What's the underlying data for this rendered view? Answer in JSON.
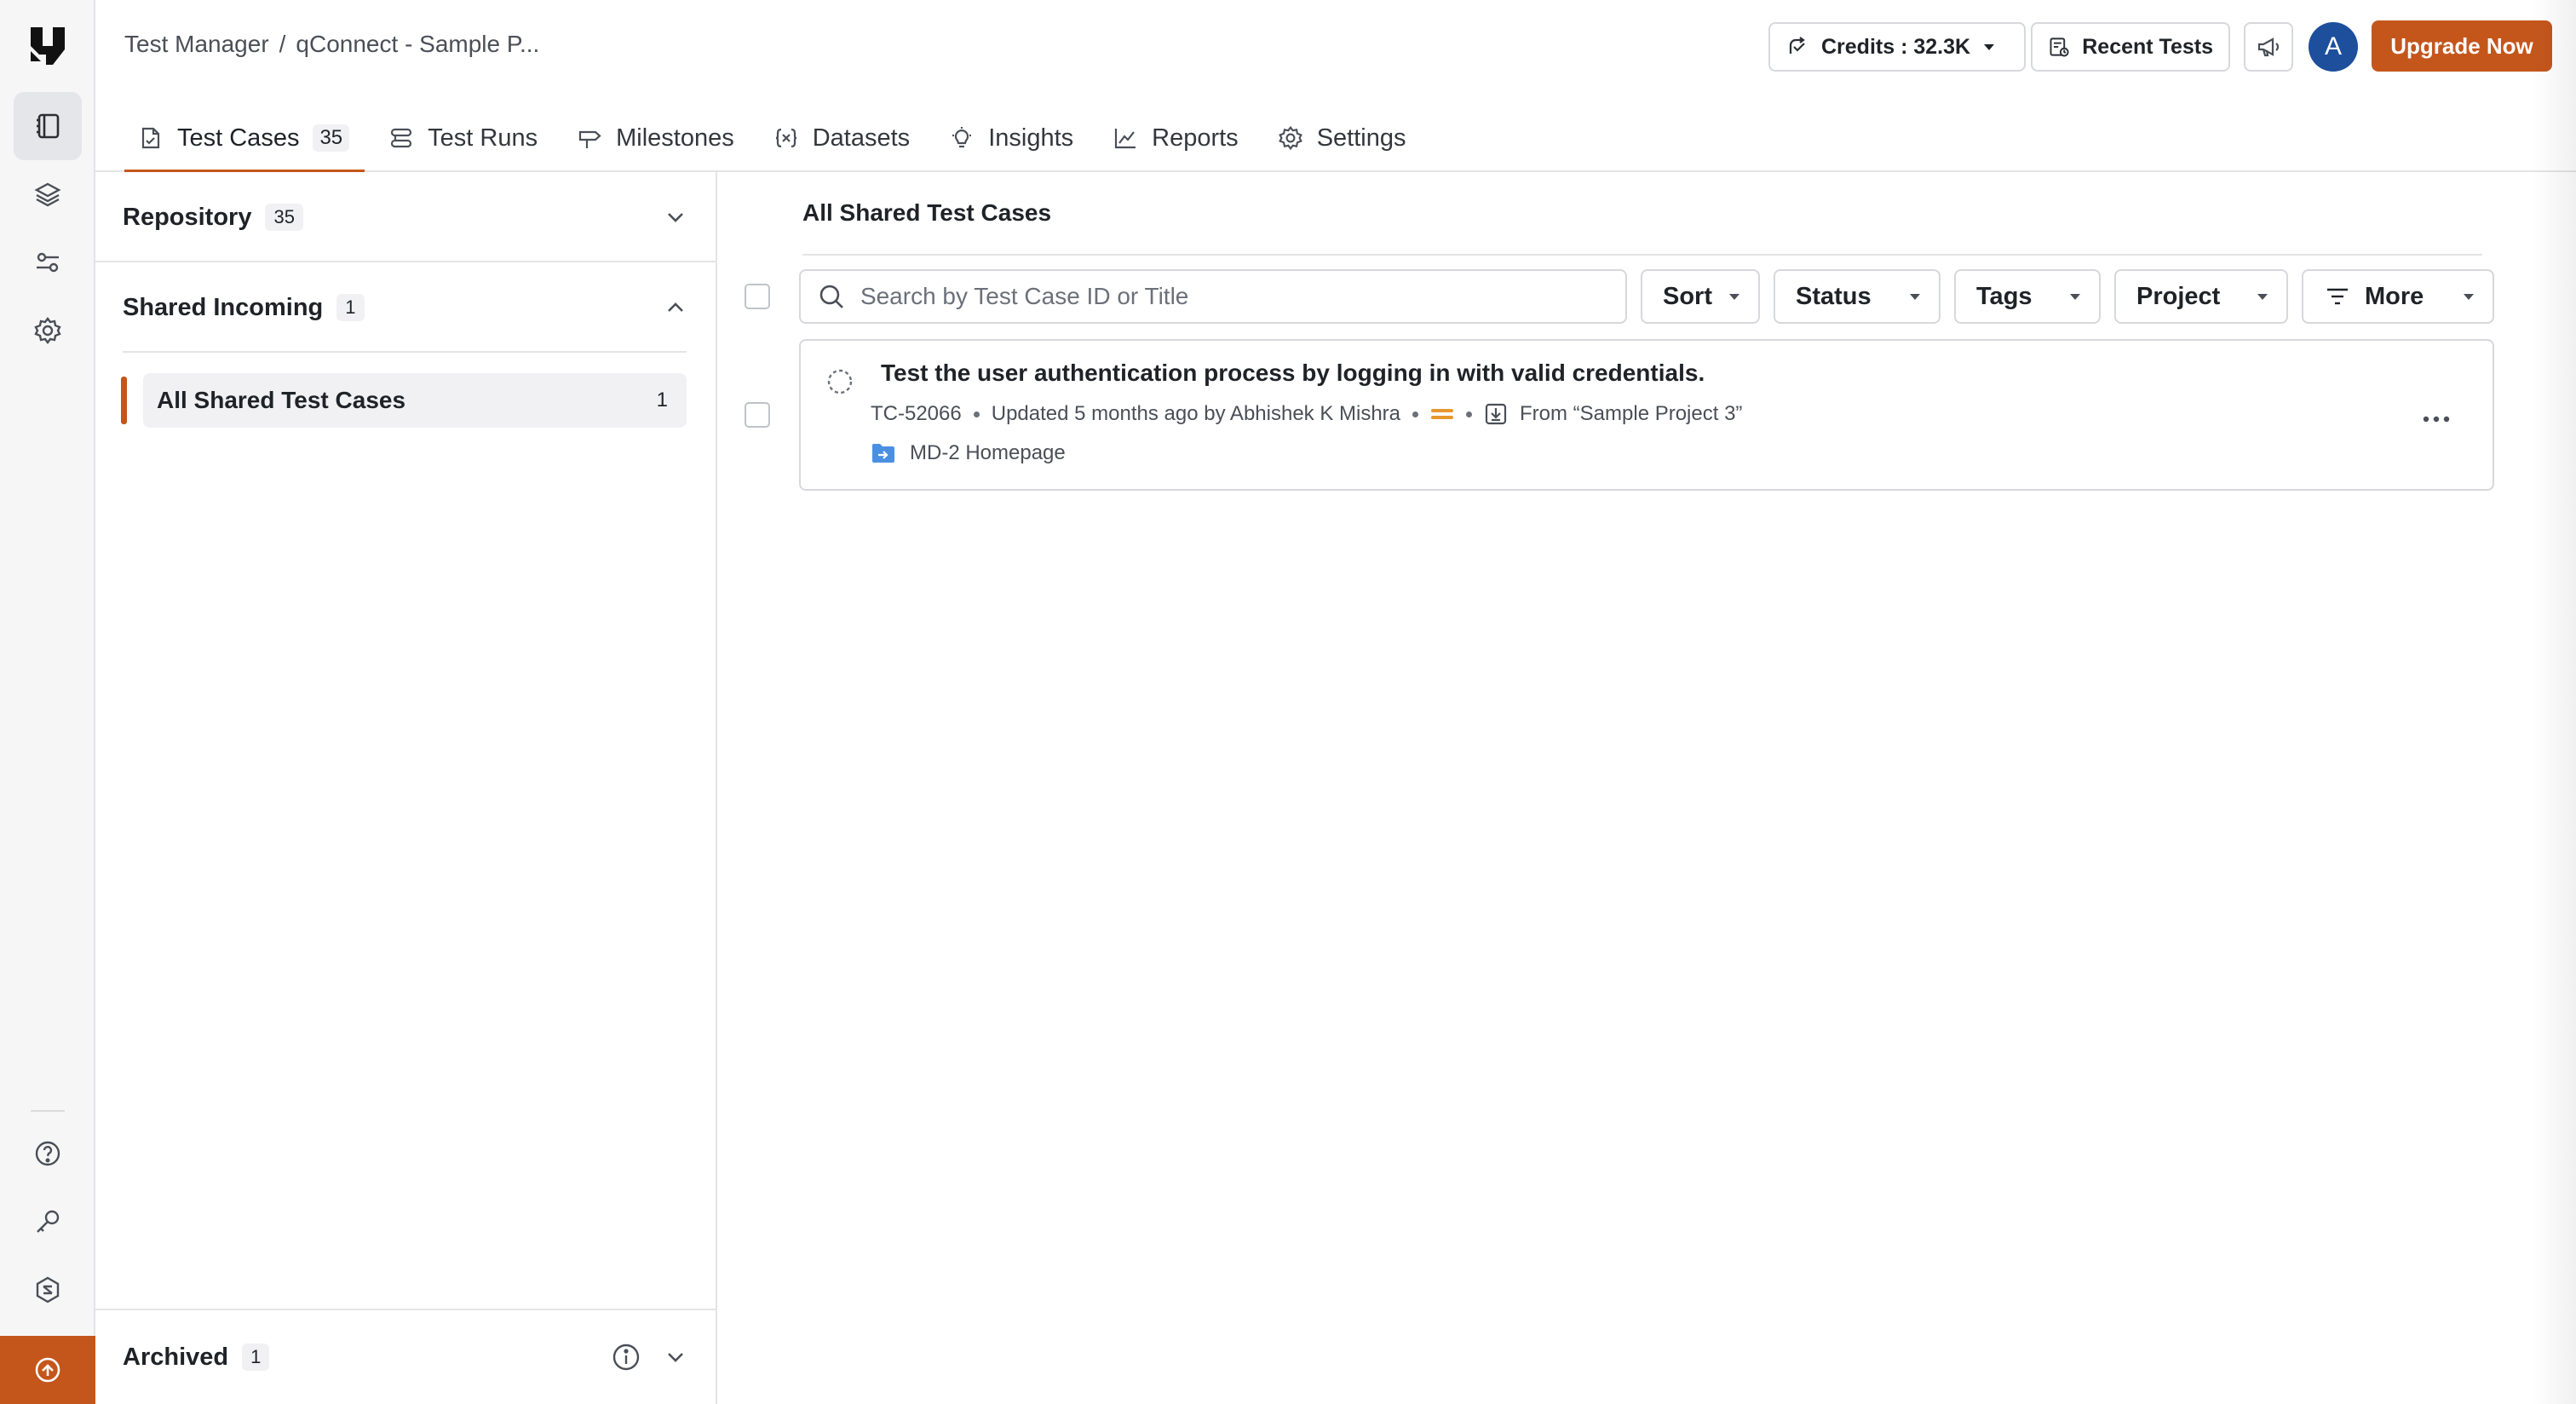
{
  "breadcrumb": {
    "root": "Test Manager",
    "separator": "/",
    "project": "qConnect - Sample P..."
  },
  "header": {
    "credits_label": "Credits : 32.3K",
    "recent_tests_label": "Recent Tests",
    "avatar_initial": "A",
    "upgrade_label": "Upgrade Now"
  },
  "tabs": [
    {
      "label": "Test Cases",
      "count": "35",
      "icon": "test-cases-icon",
      "active": true
    },
    {
      "label": "Test Runs",
      "icon": "test-runs-icon"
    },
    {
      "label": "Milestones",
      "icon": "milestone-icon"
    },
    {
      "label": "Datasets",
      "icon": "dataset-icon"
    },
    {
      "label": "Insights",
      "icon": "lightbulb-icon"
    },
    {
      "label": "Reports",
      "icon": "chart-line-icon"
    },
    {
      "label": "Settings",
      "icon": "gear-icon"
    }
  ],
  "sidebar": {
    "repository": {
      "label": "Repository",
      "count": "35"
    },
    "shared_incoming": {
      "label": "Shared Incoming",
      "count": "1"
    },
    "shared_item": {
      "label": "All Shared Test Cases",
      "count": "1"
    },
    "archived": {
      "label": "Archived",
      "count": "1"
    }
  },
  "main": {
    "title": "All Shared Test Cases",
    "search_placeholder": "Search by Test Case ID or Title",
    "filters": {
      "sort": "Sort",
      "status": "Status",
      "tags": "Tags",
      "project": "Project",
      "more": "More"
    },
    "test_cases": [
      {
        "title": "Test the user authentication process by logging in with valid credentials.",
        "id": "TC-52066",
        "updated": "Updated 5 months ago by Abhishek K Mishra",
        "source": "From “Sample Project 3”",
        "folder": "MD-2 Homepage",
        "priority_color": "#e8962e"
      }
    ]
  },
  "colors": {
    "accent": "#c4561c",
    "avatar": "#1d4f9c",
    "folder": "#4a90e2"
  }
}
